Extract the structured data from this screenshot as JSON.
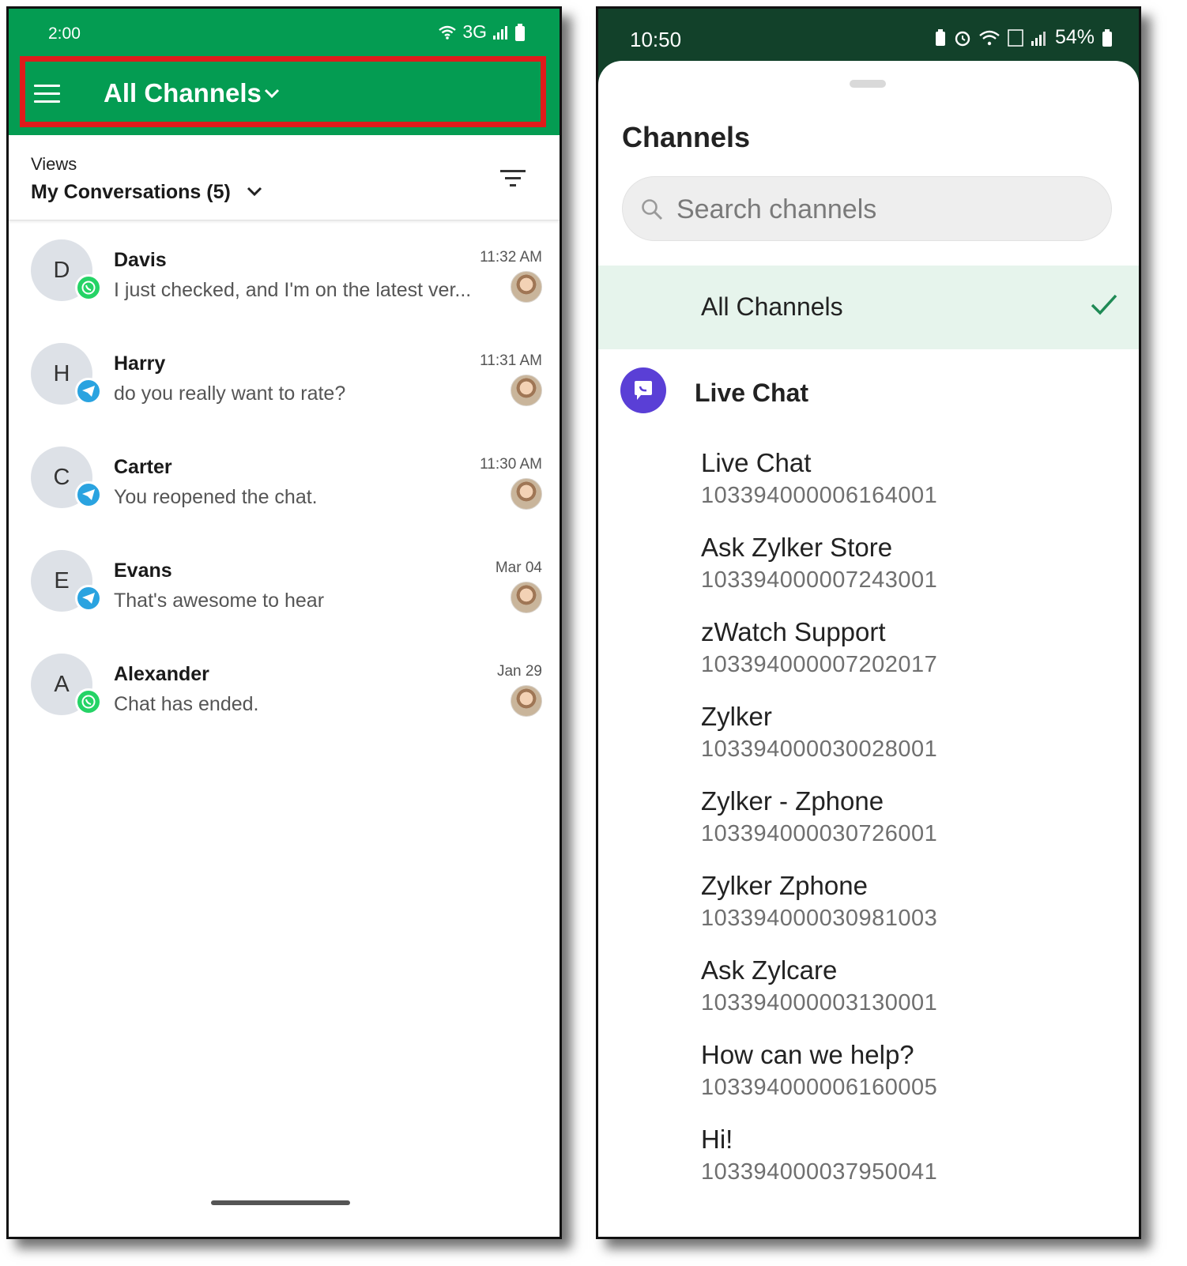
{
  "left": {
    "status": {
      "time": "2:00",
      "network": "3G"
    },
    "header": {
      "title": "All Channels"
    },
    "views": {
      "label": "Views",
      "value": "My Conversations (5)"
    },
    "conversations": [
      {
        "initial": "D",
        "name": "Davis",
        "message": "I just checked, and I'm on the latest ver...",
        "time": "11:32 AM",
        "channel_icon": "whatsapp-icon"
      },
      {
        "initial": "H",
        "name": "Harry",
        "message": "do you really want to rate?",
        "time": "11:31 AM",
        "channel_icon": "telegram-icon"
      },
      {
        "initial": "C",
        "name": "Carter",
        "message": "You reopened the chat.",
        "time": "11:30 AM",
        "channel_icon": "telegram-icon"
      },
      {
        "initial": "E",
        "name": "Evans",
        "message": "That's awesome to hear",
        "time": "Mar 04",
        "channel_icon": "telegram-icon"
      },
      {
        "initial": "A",
        "name": "Alexander",
        "message": "Chat has ended.",
        "time": "Jan 29",
        "channel_icon": "whatsapp-icon"
      }
    ]
  },
  "right": {
    "status": {
      "time": "10:50",
      "battery": "54%"
    },
    "title": "Channels",
    "search": {
      "placeholder": "Search channels"
    },
    "all_channels": {
      "label": "All Channels",
      "selected": true
    },
    "group": {
      "name": "Live Chat"
    },
    "channels": [
      {
        "name": "Live Chat",
        "id": "103394000006164001"
      },
      {
        "name": "Ask Zylker Store",
        "id": "103394000007243001"
      },
      {
        "name": "zWatch Support",
        "id": "103394000007202017"
      },
      {
        "name": "Zylker",
        "id": "103394000030028001"
      },
      {
        "name": "Zylker - Zphone",
        "id": "103394000030726001"
      },
      {
        "name": "Zylker Zphone",
        "id": "103394000030981003"
      },
      {
        "name": "Ask Zylcare",
        "id": "103394000003130001"
      },
      {
        "name": "How can we help?",
        "id": "103394000006160005"
      },
      {
        "name": "Hi!",
        "id": "103394000037950041"
      }
    ]
  },
  "colors": {
    "brand_green": "#049c52",
    "highlight": "#e01b1b",
    "whatsapp": "#25d366",
    "telegram": "#2aa3e0",
    "livechat": "#5a3fd6",
    "dark_status": "#12412a"
  }
}
